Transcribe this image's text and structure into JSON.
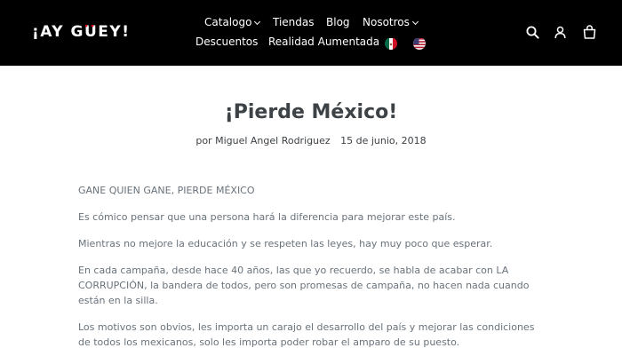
{
  "header": {
    "logo_text": "¡AY GÜEY!",
    "nav_row1": [
      "Catalogo",
      "Tiendas",
      "Blog",
      "Nosotros"
    ],
    "nav_row2": [
      "Descuentos",
      "Realidad Aumentada"
    ],
    "flags": [
      "mexico-flag-icon",
      "usa-flag-icon"
    ],
    "icons": [
      "search-icon",
      "user-icon",
      "cart-icon"
    ],
    "background": "#000000"
  },
  "article": {
    "title": "¡Pierde México!",
    "author": "por Miguel Angel Rodriguez",
    "date": "15 de junio, 2018",
    "paragraphs": [
      "GANE QUIEN GANE, PIERDE MÉXICO",
      "Es cómico pensar que una persona hará la diferencia para mejorar este país.",
      "Mientras no mejore la educación y se respeten las leyes, hay muy poco que esperar.",
      "En cada campaña, desde hace 40 años, las que yo recuerdo, se habla de acabar con LA CORRUPCIÓN, la bandera de todos, pero son promesas de campaña, no hacen nada cuando están en la silla.",
      "Los motivos son obvios, les importa un carajo  el desarrollo del país y mejorar las condiciones de todos los mexicanos,  solo les importa  poder robar el amparo de su puesto."
    ]
  }
}
